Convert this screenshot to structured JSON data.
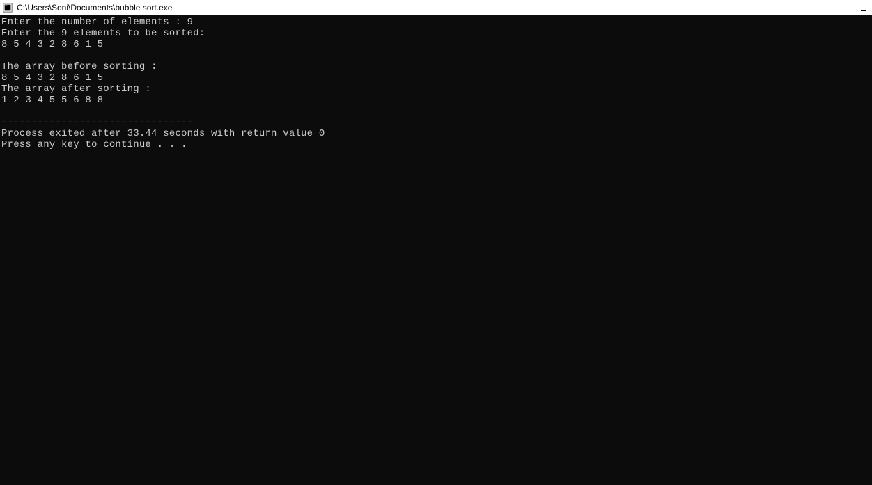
{
  "titlebar": {
    "path": "C:\\Users\\Soni\\Documents\\bubble sort.exe"
  },
  "console": {
    "lines": [
      "Enter the number of elements : 9",
      "Enter the 9 elements to be sorted:",
      "8 5 4 3 2 8 6 1 5",
      "",
      "The array before sorting :",
      "8 5 4 3 2 8 6 1 5",
      "The array after sorting :",
      "1 2 3 4 5 5 6 8 8",
      "",
      "--------------------------------",
      "Process exited after 33.44 seconds with return value 0",
      "Press any key to continue . . ."
    ]
  }
}
